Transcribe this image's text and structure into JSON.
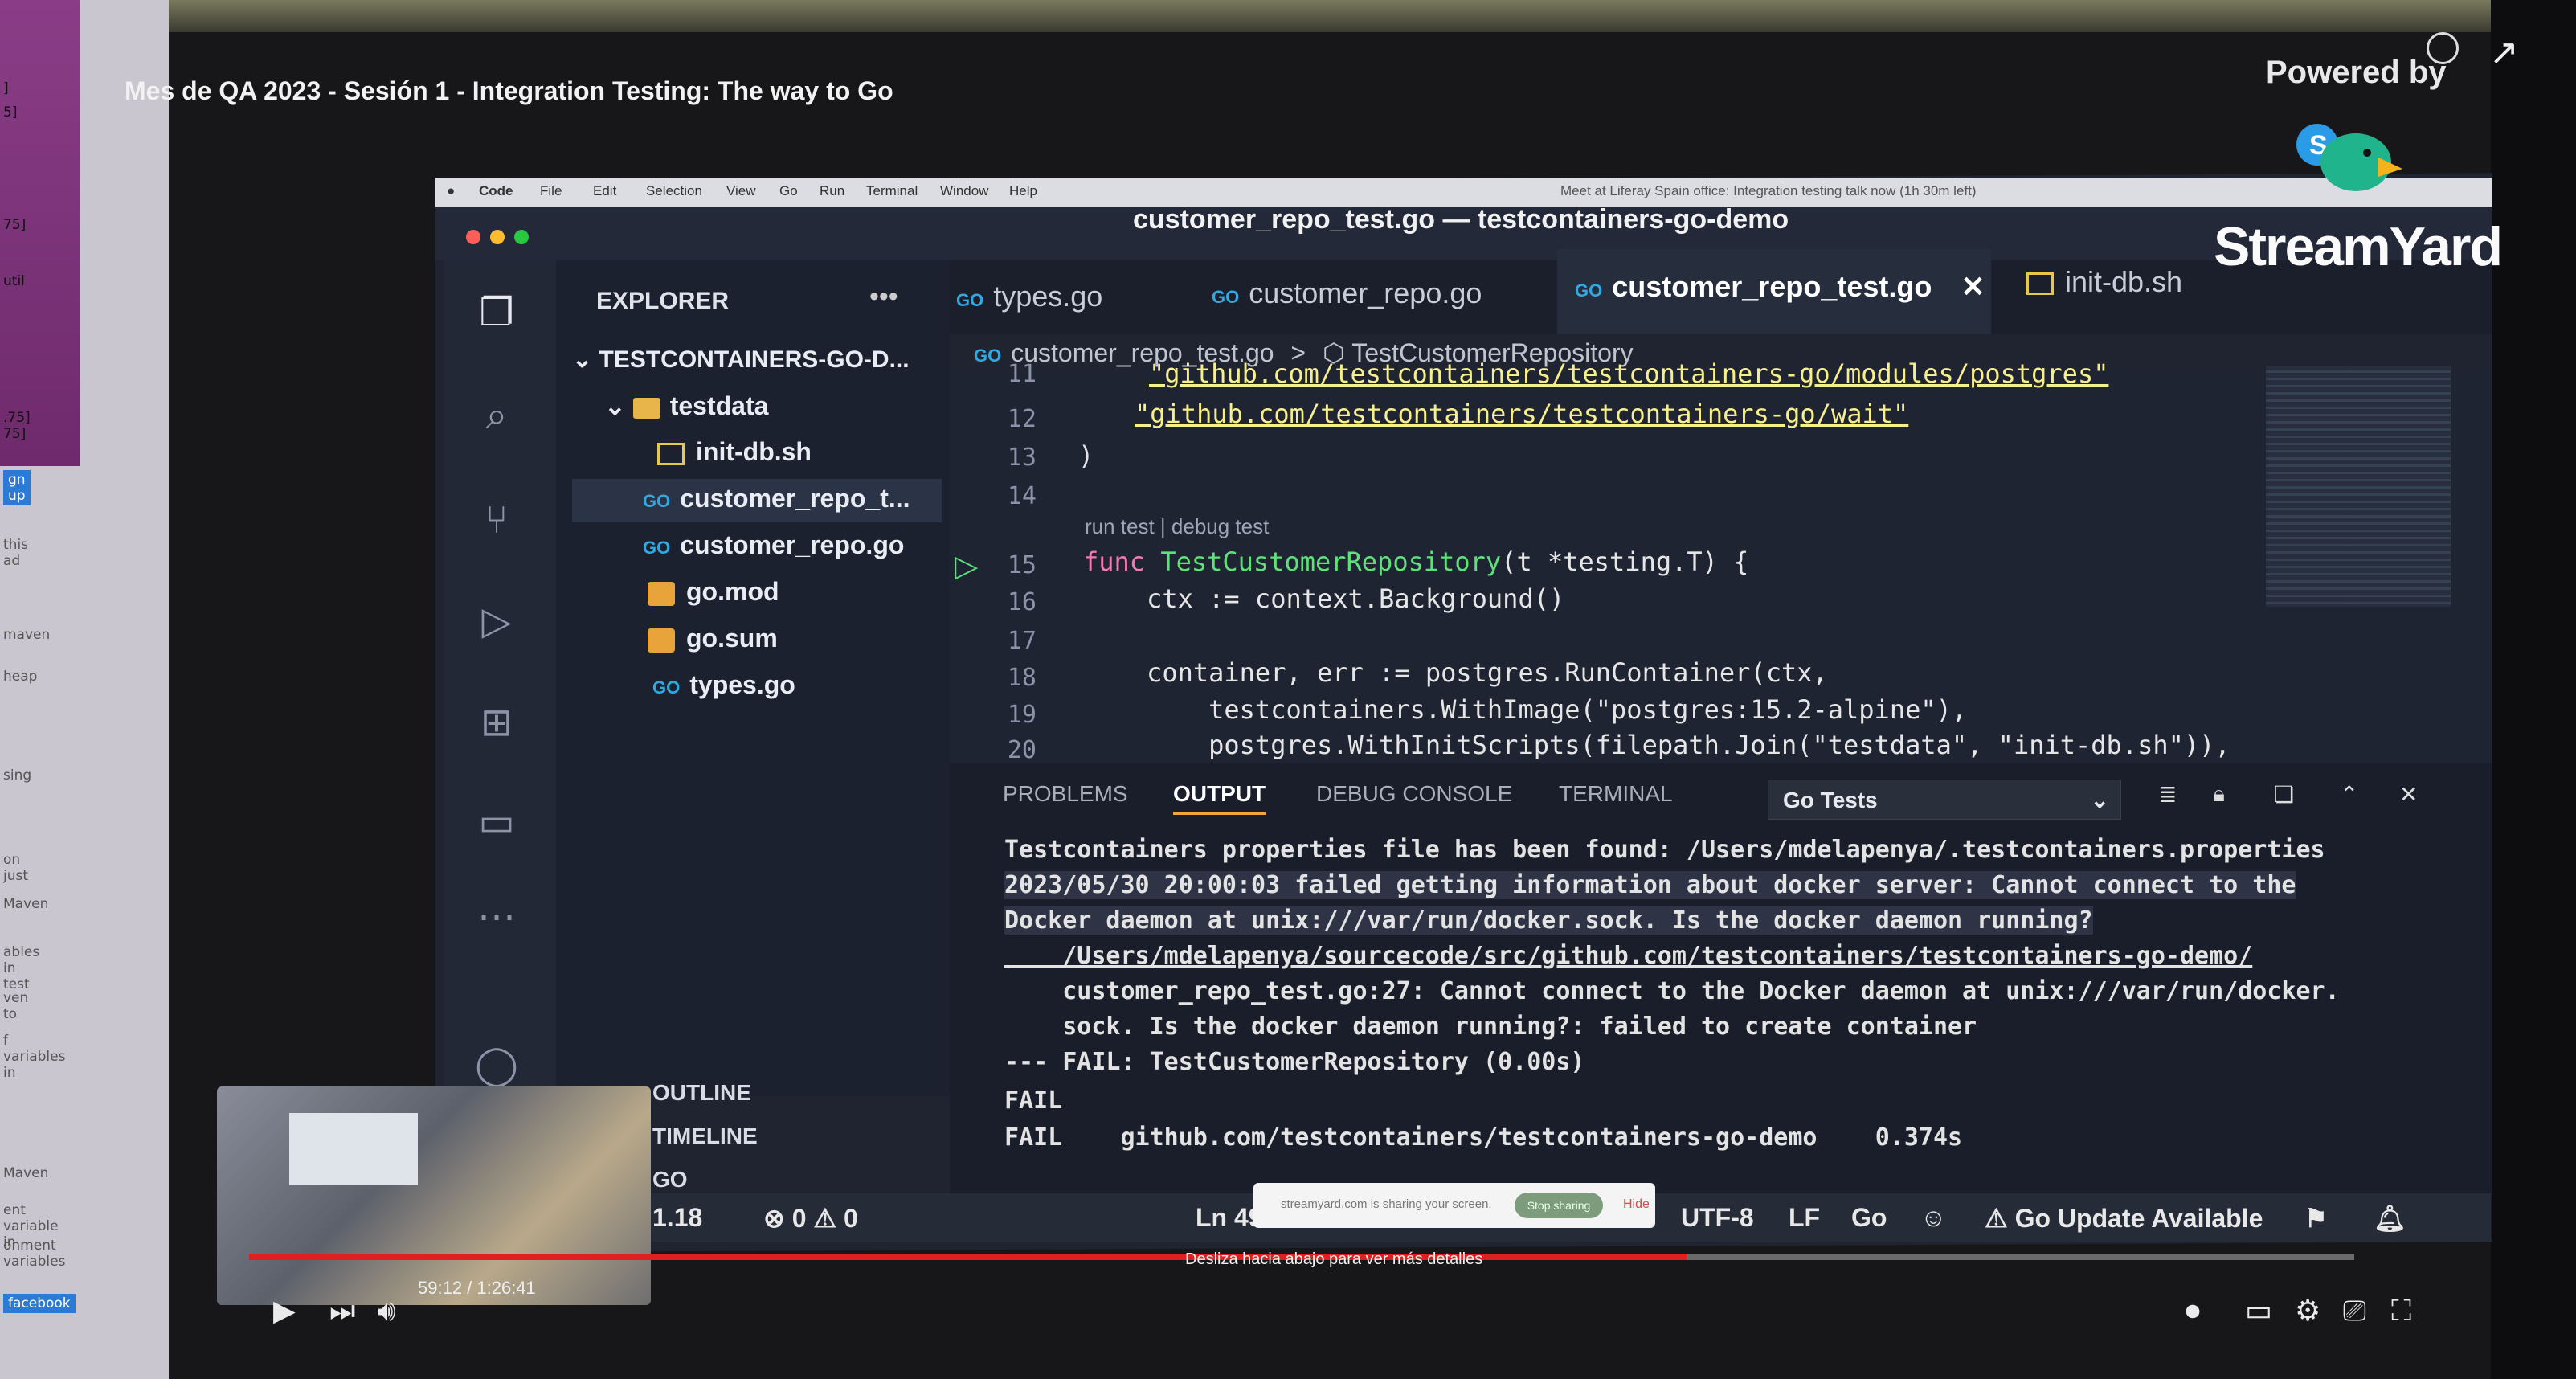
{
  "youtube": {
    "title": "Mes de QA 2023 - Sesión 1 - Integration Testing: The way to Go",
    "powered_by": "Powered by",
    "time": "59:12 / 1:26:41",
    "swipe_hint": "Desliza hacia abajo para ver más detalles",
    "progress": 0.683
  },
  "left_monitor": {
    "lines": [
      "]",
      "5]",
      "75]",
      "util",
      ".75]",
      "75]",
      "gn up",
      "this ad",
      "maven",
      "heap",
      "sing",
      "on just",
      "Maven",
      "ables in test",
      "ven to",
      "f variables in",
      "Maven",
      "ent variable in",
      "onment variables",
      "facebook"
    ]
  },
  "macos_menubar": {
    "items": [
      "Code",
      "File",
      "Edit",
      "Selection",
      "View",
      "Go",
      "Run",
      "Terminal",
      "Window",
      "Help"
    ],
    "notice": "Meet at Liferay Spain office: Integration testing talk now (1h 30m left)"
  },
  "window_title": "customer_repo_test.go — testcontainers-go-demo",
  "explorer": {
    "label": "EXPLORER",
    "more": "•••",
    "project": "TESTCONTAINERS-GO-D...",
    "tree": [
      "testdata",
      "init-db.sh",
      "customer_repo_t...",
      "customer_repo.go",
      "go.mod",
      "go.sum",
      "types.go"
    ],
    "go_tag": "GO",
    "sections": [
      "OUTLINE",
      "TIMELINE",
      "GO"
    ]
  },
  "tabs": [
    {
      "label": "types.go"
    },
    {
      "label": "customer_repo.go"
    },
    {
      "label": "customer_repo_test.go",
      "close": "✕"
    },
    {
      "label": "init-db.sh"
    }
  ],
  "breadcrumb": {
    "file": "customer_repo_test.go",
    "sep": ">",
    "symbol": "TestCustomerRepository"
  },
  "editor": {
    "codelens": "run test | debug test",
    "lines": [
      {
        "n": "11",
        "text": "\"github.com/testcontainers/testcontainers-go/modules/postgres\""
      },
      {
        "n": "12",
        "text": "\"github.com/testcontainers/testcontainers-go/wait\""
      },
      {
        "n": "13",
        "text": ")"
      },
      {
        "n": "14",
        "text": ""
      },
      {
        "n": "15",
        "kw": "func ",
        "fn": "TestCustomerRepository",
        "rest": "(t *testing.T) {"
      },
      {
        "n": "16",
        "text": "    ctx := context.Background()"
      },
      {
        "n": "17",
        "text": ""
      },
      {
        "n": "18",
        "text": "    container, err := postgres.RunContainer(ctx,"
      },
      {
        "n": "19",
        "text": "        testcontainers.WithImage(\"postgres:15.2-alpine\"),"
      },
      {
        "n": "20",
        "text": "        postgres.WithInitScripts(filepath.Join(\"testdata\", \"init-db.sh\")),"
      }
    ]
  },
  "panel": {
    "tabs": [
      "PROBLEMS",
      "OUTPUT",
      "DEBUG CONSOLE",
      "TERMINAL"
    ],
    "selected_channel": "Go Tests",
    "output": [
      "Testcontainers properties file has been found: /Users/mdelapenya/.testcontainers.properties",
      "2023/05/30 20:00:03 failed getting information about docker server: Cannot connect to the",
      "Docker daemon at unix:///var/run/docker.sock. Is the docker daemon running?",
      "    /Users/mdelapenya/sourcecode/src/github.com/testcontainers/testcontainers-go-demo/",
      "    customer_repo_test.go:27: Cannot connect to the Docker daemon at unix:///var/run/docker.",
      "    sock. Is the docker daemon running?: failed to create container",
      "--- FAIL: TestCustomerRepository (0.00s)",
      "FAIL",
      "FAIL    github.com/testcontainers/testcontainers-go-demo    0.374s"
    ]
  },
  "statusbar": {
    "version": "1.18",
    "errors": "0",
    "warnings": "0",
    "position": "Ln 49",
    "encoding": "UTF-8",
    "eol": "LF",
    "language": "Go",
    "update": "Go Update Available",
    "share_notice": "streamyard.com is sharing your screen.",
    "stop_sharing": "Stop sharing",
    "hide": "Hide"
  },
  "streamyard": {
    "brand": "StreamYard",
    "s_badge": "S"
  },
  "colors": {
    "accent": "#e02020",
    "editor_bg": "#1f2433",
    "keyword": "#f07ab3",
    "function": "#5ee07a",
    "string": "#f7f08a"
  }
}
